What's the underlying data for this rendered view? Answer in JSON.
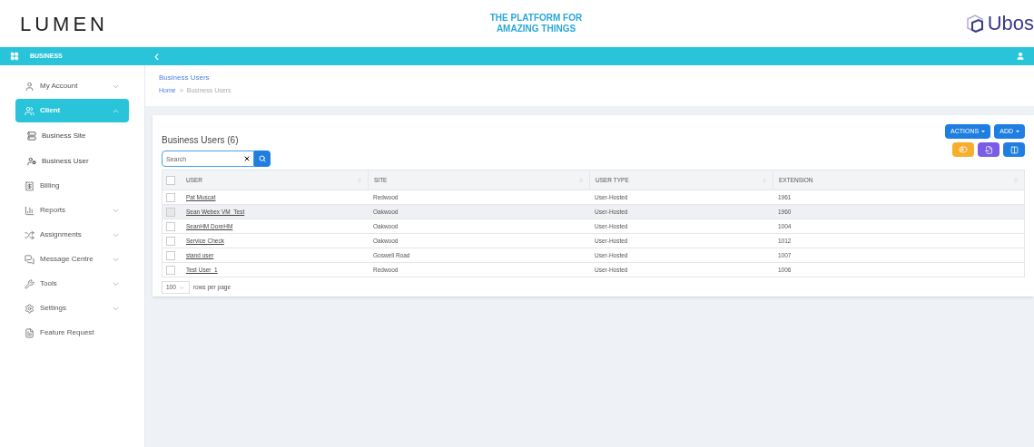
{
  "header": {
    "logo": "LUMEN",
    "tagline": [
      "THE PLATFORM FOR",
      "AMAZING THINGS"
    ],
    "brand": "Ubos"
  },
  "topbar": {
    "section": "BUSINESS",
    "back": "‹"
  },
  "sidebar": {
    "items": [
      {
        "label": "My Account",
        "expanded": false,
        "selected": false
      },
      {
        "label": "Client",
        "expanded": true,
        "selected": true,
        "children": [
          {
            "label": "Business Site"
          },
          {
            "label": "Business User"
          }
        ]
      },
      {
        "label": "Billing"
      },
      {
        "label": "Reports",
        "expanded": false,
        "selected": false
      },
      {
        "label": "Assignments",
        "expanded": false,
        "selected": false
      },
      {
        "label": "Message Centre",
        "expanded": false,
        "selected": false
      },
      {
        "label": "Tools",
        "expanded": false,
        "selected": false
      },
      {
        "label": "Settings",
        "expanded": false,
        "selected": false
      },
      {
        "label": "Feature Request"
      }
    ]
  },
  "page": {
    "title": "Business Users",
    "breadcrumb": [
      "Home",
      "Business Users"
    ],
    "separator": ">"
  },
  "card": {
    "title": "Business Users (6)",
    "search": {
      "placeholder": "Search"
    },
    "buttons": [
      "ACTIONS",
      "ADD"
    ],
    "table": {
      "all_checked": false,
      "columns": [
        "USER",
        "SITE",
        "USER TYPE",
        "EXTENSION"
      ],
      "rows": [
        {
          "cells": [
            "Pat Muscat",
            "Redwood",
            "User-Hosted",
            "1961"
          ],
          "checked": false,
          "hovered": false
        },
        {
          "cells": [
            "Sean Webex VM_Test",
            "Oakwood",
            "User-Hosted",
            "1960"
          ],
          "checked": false,
          "hovered": true
        },
        {
          "cells": [
            "SeanHM DoreHM",
            "Oakwood",
            "User-Hosted",
            "1004"
          ],
          "checked": false,
          "hovered": false
        },
        {
          "cells": [
            "Service Check",
            "Oakwood",
            "User-Hosted",
            "1012"
          ],
          "checked": false,
          "hovered": false
        },
        {
          "cells": [
            "stand user",
            "Goswell Road",
            "User-Hosted",
            "1007"
          ],
          "checked": false,
          "hovered": false
        },
        {
          "cells": [
            "Test User_1",
            "Redwood",
            "User-Hosted",
            "1006"
          ],
          "checked": false,
          "hovered": false
        }
      ]
    },
    "pager": {
      "size": "100",
      "label": "rows per page"
    }
  }
}
